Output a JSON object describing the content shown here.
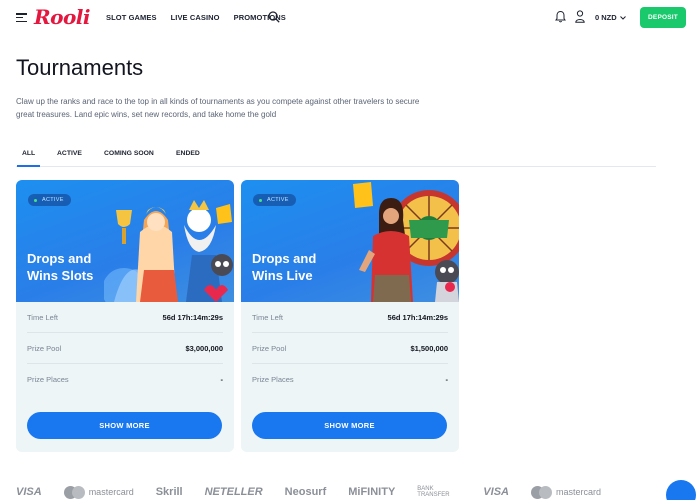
{
  "header": {
    "logo": "Rooli",
    "nav": [
      "SLOT GAMES",
      "LIVE CASINO",
      "PROMOTIONS"
    ],
    "balance": "0 NZD",
    "deposit_label": "DEPOSIT",
    "icons": [
      "menu-icon",
      "search-icon",
      "bell-icon",
      "user-icon",
      "chevron-down-icon"
    ]
  },
  "page": {
    "title": "Tournaments",
    "intro": "Claw up the ranks and race to the top in all kinds of tournaments as you compete against other travelers to secure great treasures. Land epic wins, set new records, and take home the gold"
  },
  "tabs": [
    "ALL",
    "ACTIVE",
    "COMING SOON",
    "ENDED"
  ],
  "active_tab": "ALL",
  "tournaments": [
    {
      "status": "ACTIVE",
      "title": "Drops and Wins Slots",
      "rows": [
        {
          "label": "Time Left",
          "value": "56d 17h:14m:29s"
        },
        {
          "label": "Prize Pool",
          "value": "$3,000,000"
        },
        {
          "label": "Prize Places",
          "value": "-"
        }
      ],
      "button": "SHOW MORE"
    },
    {
      "status": "ACTIVE",
      "title": "Drops and Wins Live",
      "rows": [
        {
          "label": "Time Left",
          "value": "56d 17h:14m:29s"
        },
        {
          "label": "Prize Pool",
          "value": "$1,500,000"
        },
        {
          "label": "Prize Places",
          "value": "-"
        }
      ],
      "button": "SHOW MORE"
    }
  ],
  "payments": [
    "VISA",
    "mastercard",
    "Skrill",
    "NETELLER",
    "Neosurf",
    "MiFINITY",
    "BANK TRANSFER",
    "VISA",
    "mastercard"
  ],
  "colors": {
    "brand": "#e4173e",
    "deposit": "#19c96c",
    "primary": "#1977f0",
    "card_bg": "#edf5f7"
  }
}
